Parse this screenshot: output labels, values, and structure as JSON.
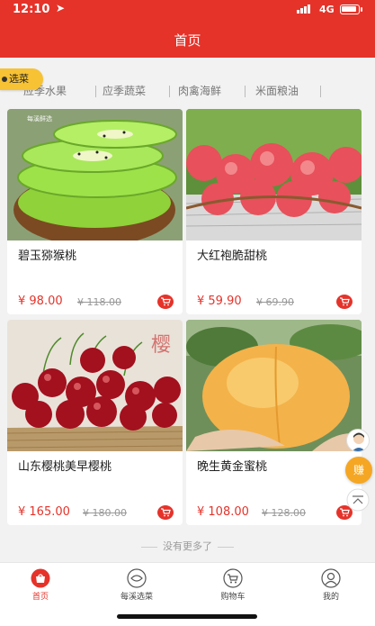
{
  "status_bar": {
    "time": "12:10",
    "network": "4G"
  },
  "header": {
    "title": "首页"
  },
  "category_badge": "选菜",
  "categories": [
    "应季水果",
    "应季蔬菜",
    "肉禽海鲜",
    "米面粮油"
  ],
  "watermark": "每溪鲜选",
  "products": [
    {
      "name": "碧玉猕猴桃",
      "price": "¥ 98.00",
      "original_price": "¥ 118.00"
    },
    {
      "name": "大红袍脆甜桃",
      "price": "¥ 59.90",
      "original_price": "¥ 69.90"
    },
    {
      "name": "山东樱桃美早樱桃",
      "price": "¥ 165.00",
      "original_price": "¥ 180.00"
    },
    {
      "name": "晚生黄金蜜桃",
      "price": "¥ 108.00",
      "original_price": "¥ 128.00"
    }
  ],
  "no_more_text": "没有更多了",
  "float_buttons": {
    "earn": "赚"
  },
  "tab_bar": {
    "items": [
      {
        "label": "首页",
        "icon": "home-bag-icon",
        "active": true
      },
      {
        "label": "每溪选菜",
        "icon": "vegetable-icon",
        "active": false
      },
      {
        "label": "购物车",
        "icon": "cart-icon",
        "active": false
      },
      {
        "label": "我的",
        "icon": "user-icon",
        "active": false
      }
    ]
  },
  "colors": {
    "brand_red": "#e5332a",
    "badge_yellow": "#f7c234",
    "earn_orange": "#f5a623"
  }
}
